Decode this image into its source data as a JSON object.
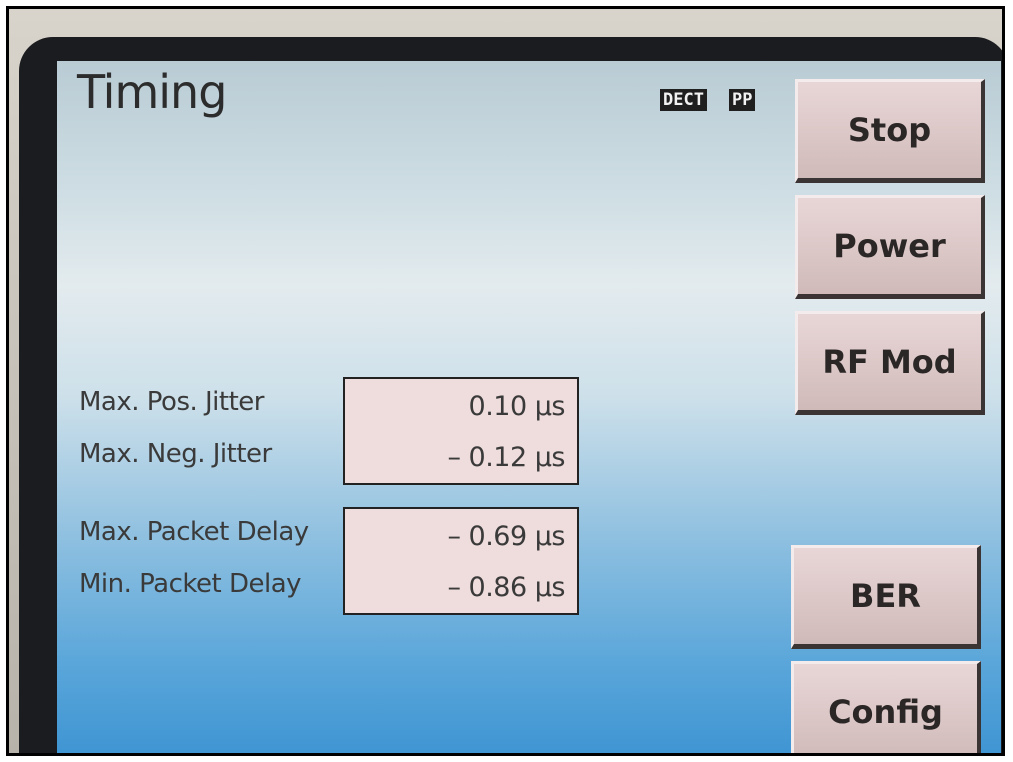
{
  "screen": {
    "title": "Timing",
    "badges": [
      "DECT",
      "PP"
    ]
  },
  "softkeys": {
    "stop": "Stop",
    "power": "Power",
    "rf_mod": "RF Mod",
    "ber": "BER",
    "config": "Config"
  },
  "measurements": {
    "jitter": [
      {
        "label": "Max. Pos. Jitter",
        "value": "0.10 µs"
      },
      {
        "label": "Max. Neg. Jitter",
        "value": "– 0.12 µs"
      }
    ],
    "packet_delay": [
      {
        "label": "Max. Packet Delay",
        "value": "– 0.69 µs"
      },
      {
        "label": "Min. Packet Delay",
        "value": "– 0.86 µs"
      }
    ]
  },
  "colors": {
    "screen_top": "#cddde3",
    "screen_bottom": "#3d94d2",
    "softkey_face": "#dcc7c7",
    "value_box": "#efdcdc"
  }
}
